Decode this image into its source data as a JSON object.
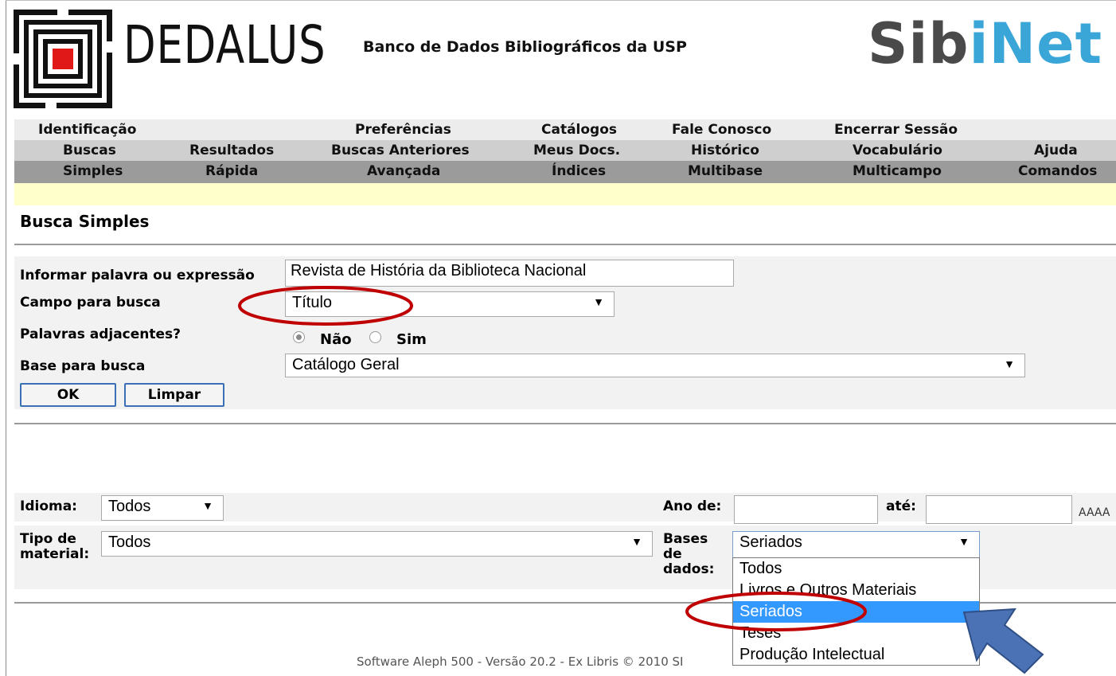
{
  "header": {
    "brand": "DEDALUS",
    "subtitle": "Banco de Dados Bibliográficos da USP",
    "sibinet_a": "Sib",
    "sibinet_b": "iNet"
  },
  "menu": {
    "row1": [
      "Identificação",
      "Preferências",
      "Catálogos",
      "Fale Conosco",
      "Encerrar Sessão"
    ],
    "row2": [
      "Buscas",
      "Resultados",
      "Buscas Anteriores",
      "Meus Docs.",
      "Histórico",
      "Vocabulário",
      "Ajuda"
    ],
    "row3": [
      "Simples",
      "Rápida",
      "Avançada",
      "Índices",
      "Multibase",
      "Multicampo",
      "Comandos"
    ]
  },
  "page_title": "Busca Simples",
  "form": {
    "term_label": "Informar palavra ou expressão",
    "term_value": "Revista de História da Biblioteca Nacional",
    "field_label": "Campo para busca",
    "field_value": "Título",
    "adjacent_label": "Palavras adjacentes?",
    "adjacent_no": "Não",
    "adjacent_yes": "Sim",
    "base_label": "Base para busca",
    "base_value": "Catálogo Geral",
    "ok_label": "OK",
    "clear_label": "Limpar"
  },
  "filters": {
    "language_label": "Idioma:",
    "language_value": "Todos",
    "year_from_label": "Ano de:",
    "year_to_label": "até:",
    "year_format": "AAAA",
    "material_label_1": "Tipo de",
    "material_label_2": "material:",
    "material_value": "Todos",
    "db_label_1": "Bases",
    "db_label_2": "de",
    "db_label_3": "dados:",
    "db_value": "Seriados",
    "db_options": [
      "Todos",
      "Livros e Outros Materiais",
      "Seriados",
      "Teses",
      "Produção Intelectual"
    ],
    "db_selected_index": 2
  },
  "footer": "Software Aleph 500 - Versão 20.2 - Ex Libris © 2010 SI",
  "colors": {
    "highlight_circle": "#c00000",
    "arrow_fill": "#4a72b5",
    "selected_option": "#3399ff"
  }
}
